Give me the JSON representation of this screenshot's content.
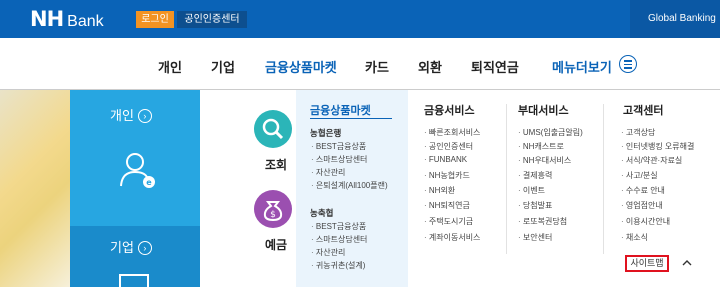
{
  "brand": {
    "nh": "NH",
    "bank": "Bank"
  },
  "topbar": {
    "login": "로그인",
    "cert": "공인인증센터",
    "global": "Global Banking"
  },
  "nav": {
    "items": [
      "개인",
      "기업",
      "금융상품마켓",
      "카드",
      "외환",
      "퇴직연금"
    ],
    "active_index": 2,
    "more": "메뉴더보기"
  },
  "side": {
    "section1": "개인",
    "section2": "기업"
  },
  "mid": {
    "label1": "조회",
    "label2": "예금"
  },
  "menu": {
    "col1": {
      "title": "금융상품마켓",
      "group1": {
        "title": "농협은행",
        "items": [
          "BEST금융상품",
          "스마트상담센터",
          "자산관리",
          "은퇴설계(All100플랜)"
        ]
      },
      "group2": {
        "title": "농축협",
        "items": [
          "BEST금융상품",
          "스마트상담센터",
          "자산관리",
          "귀농귀촌(설계)"
        ]
      }
    },
    "col2": {
      "title": "금융서비스",
      "items": [
        "빠른조회서비스",
        "공인인증센터",
        "FUNBANK",
        "NH농협카드",
        "NH외환",
        "NH퇴직연금",
        "주택도시기금",
        "계좌이동서비스"
      ]
    },
    "col3": {
      "title": "부대서비스",
      "items": [
        "UMS(입출금알림)",
        "NH캐스트로",
        "NH우대서비스",
        "결제흥력",
        "이벤트",
        "당첨발표",
        "로또복권당첨",
        "보안센터"
      ]
    },
    "col4": {
      "title": "고객센터",
      "items": [
        "고객상담",
        "인터넷뱅킹 오류해결",
        "서식/약관·자료실",
        "사고/분실",
        "수수료 안내",
        "영업점안내",
        "이용시간안내",
        "채소식"
      ]
    },
    "sitemap": "사이트맵"
  },
  "colors": {
    "primary": "#0a63b7",
    "orange": "#f39322",
    "sky": "#27a6e1",
    "teal": "#2bb5b8",
    "purple": "#9b4fb0"
  }
}
